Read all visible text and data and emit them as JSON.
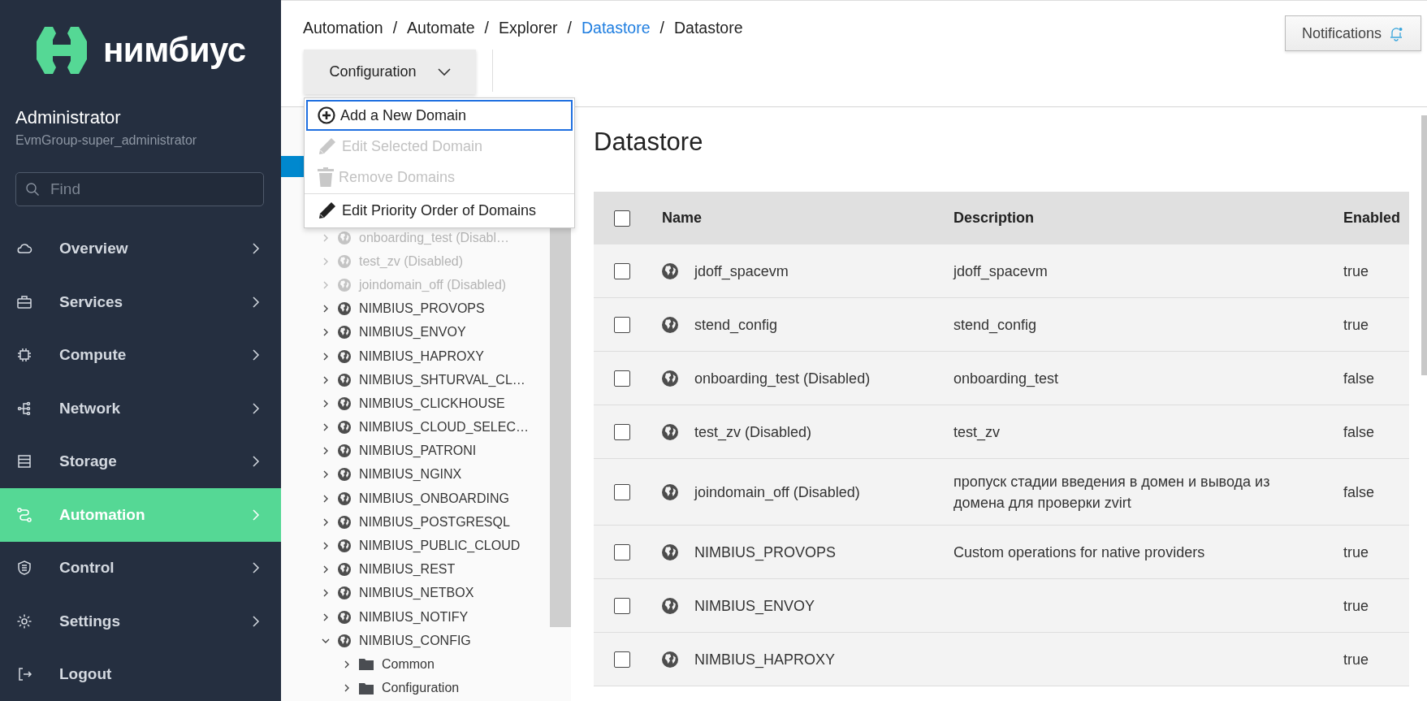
{
  "sidebar": {
    "logo": "нимбиус",
    "user": {
      "name": "Administrator",
      "role": "EvmGroup-super_administrator"
    },
    "search": {
      "placeholder": "Find"
    },
    "nav": [
      {
        "label": "Overview",
        "selected": false,
        "expandable": true
      },
      {
        "label": "Services",
        "selected": false,
        "expandable": true
      },
      {
        "label": "Compute",
        "selected": false,
        "expandable": true
      },
      {
        "label": "Network",
        "selected": false,
        "expandable": true
      },
      {
        "label": "Storage",
        "selected": false,
        "expandable": true
      },
      {
        "label": "Automation",
        "selected": true,
        "expandable": true
      },
      {
        "label": "Control",
        "selected": false,
        "expandable": true
      },
      {
        "label": "Settings",
        "selected": false,
        "expandable": true
      },
      {
        "label": "Logout",
        "selected": false,
        "expandable": false
      }
    ]
  },
  "breadcrumb_separator": "/",
  "breadcrumb": [
    {
      "label": "Automation",
      "link": false
    },
    {
      "label": "Automate",
      "link": false
    },
    {
      "label": "Explorer",
      "link": false
    },
    {
      "label": "Datastore",
      "link": true
    },
    {
      "label": "Datastore",
      "link": false
    }
  ],
  "notifications": {
    "label": "Notifications"
  },
  "toolbar": {
    "configuration": {
      "label": "Configuration",
      "expanded": true
    }
  },
  "menu": [
    {
      "label": "Add a New Domain",
      "kind": "add",
      "disabled": false,
      "focused": true,
      "separator_before": false
    },
    {
      "label": "Edit Selected Domain",
      "kind": "edit",
      "disabled": true,
      "focused": false,
      "separator_before": false
    },
    {
      "label": "Remove Domains",
      "kind": "remove",
      "disabled": true,
      "focused": false,
      "separator_before": false
    },
    {
      "label": "Edit Priority Order of Domains",
      "kind": "edit",
      "disabled": false,
      "focused": false,
      "separator_before": true
    }
  ],
  "tree": {
    "selected_row": {
      "selected": true
    },
    "items": [
      {
        "label": "onboarding_test (Disabl…",
        "kind": "domain",
        "disabled": true,
        "expanded": false
      },
      {
        "label": "test_zv (Disabled)",
        "kind": "domain",
        "disabled": true,
        "expanded": false
      },
      {
        "label": "joindomain_off (Disabled)",
        "kind": "domain",
        "disabled": true,
        "expanded": false
      },
      {
        "label": "NIMBIUS_PROVOPS",
        "kind": "domain",
        "disabled": false,
        "expanded": false
      },
      {
        "label": "NIMBIUS_ENVOY",
        "kind": "domain",
        "disabled": false,
        "expanded": false
      },
      {
        "label": "NIMBIUS_HAPROXY",
        "kind": "domain",
        "disabled": false,
        "expanded": false
      },
      {
        "label": "NIMBIUS_SHTURVAL_CL…",
        "kind": "domain",
        "disabled": false,
        "expanded": false
      },
      {
        "label": "NIMBIUS_CLICKHOUSE",
        "kind": "domain",
        "disabled": false,
        "expanded": false
      },
      {
        "label": "NIMBIUS_CLOUD_SELEC…",
        "kind": "domain",
        "disabled": false,
        "expanded": false
      },
      {
        "label": "NIMBIUS_PATRONI",
        "kind": "domain",
        "disabled": false,
        "expanded": false
      },
      {
        "label": "NIMBIUS_NGINX",
        "kind": "domain",
        "disabled": false,
        "expanded": false
      },
      {
        "label": "NIMBIUS_ONBOARDING",
        "kind": "domain",
        "disabled": false,
        "expanded": false
      },
      {
        "label": "NIMBIUS_POSTGRESQL",
        "kind": "domain",
        "disabled": false,
        "expanded": false
      },
      {
        "label": "NIMBIUS_PUBLIC_CLOUD",
        "kind": "domain",
        "disabled": false,
        "expanded": false
      },
      {
        "label": "NIMBIUS_REST",
        "kind": "domain",
        "disabled": false,
        "expanded": false
      },
      {
        "label": "NIMBIUS_NETBOX",
        "kind": "domain",
        "disabled": false,
        "expanded": false
      },
      {
        "label": "NIMBIUS_NOTIFY",
        "kind": "domain",
        "disabled": false,
        "expanded": false
      },
      {
        "label": "NIMBIUS_CONFIG",
        "kind": "domain",
        "disabled": false,
        "expanded": true,
        "children": [
          {
            "label": "Common",
            "kind": "folder",
            "disabled": false,
            "expanded": false
          },
          {
            "label": "Configuration",
            "kind": "folder",
            "disabled": false,
            "expanded": false
          }
        ]
      }
    ]
  },
  "content": {
    "title": "Datastore",
    "table": {
      "columns": [
        "Name",
        "Description",
        "Enabled"
      ],
      "header_checked": false,
      "rows": [
        {
          "name": "jdoff_spacevm",
          "description": "jdoff_spacevm",
          "enabled": "true",
          "checked": false
        },
        {
          "name": "stend_config",
          "description": "stend_config",
          "enabled": "true",
          "checked": false
        },
        {
          "name": "onboarding_test (Disabled)",
          "description": "onboarding_test",
          "enabled": "false",
          "checked": false
        },
        {
          "name": "test_zv (Disabled)",
          "description": "test_zv",
          "enabled": "false",
          "checked": false
        },
        {
          "name": "joindomain_off (Disabled)",
          "description": "пропуск стадии введения в домен и вывода из домена для проверки zvirt",
          "enabled": "false",
          "checked": false
        },
        {
          "name": "NIMBIUS_PROVOPS",
          "description": "Custom operations for native providers",
          "enabled": "true",
          "checked": false
        },
        {
          "name": "NIMBIUS_ENVOY",
          "enabled": "true",
          "checked": false
        },
        {
          "name": "NIMBIUS_HAPROXY",
          "enabled": "true",
          "checked": false
        }
      ]
    }
  }
}
